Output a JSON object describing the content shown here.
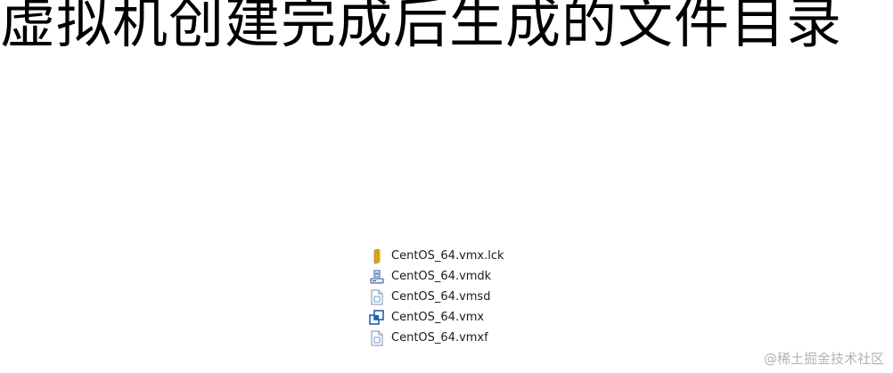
{
  "heading": "虚拟机创建完成后生成的文件目录",
  "files": [
    {
      "name": "CentOS_64.vmx.lck",
      "icon": "folder-icon"
    },
    {
      "name": "CentOS_64.vmdk",
      "icon": "virtual-disk-icon"
    },
    {
      "name": "CentOS_64.vmsd",
      "icon": "document-icon"
    },
    {
      "name": "CentOS_64.vmx",
      "icon": "vmware-config-icon"
    },
    {
      "name": "CentOS_64.vmxf",
      "icon": "document-icon"
    }
  ],
  "watermark": "@稀土掘金技术社区"
}
